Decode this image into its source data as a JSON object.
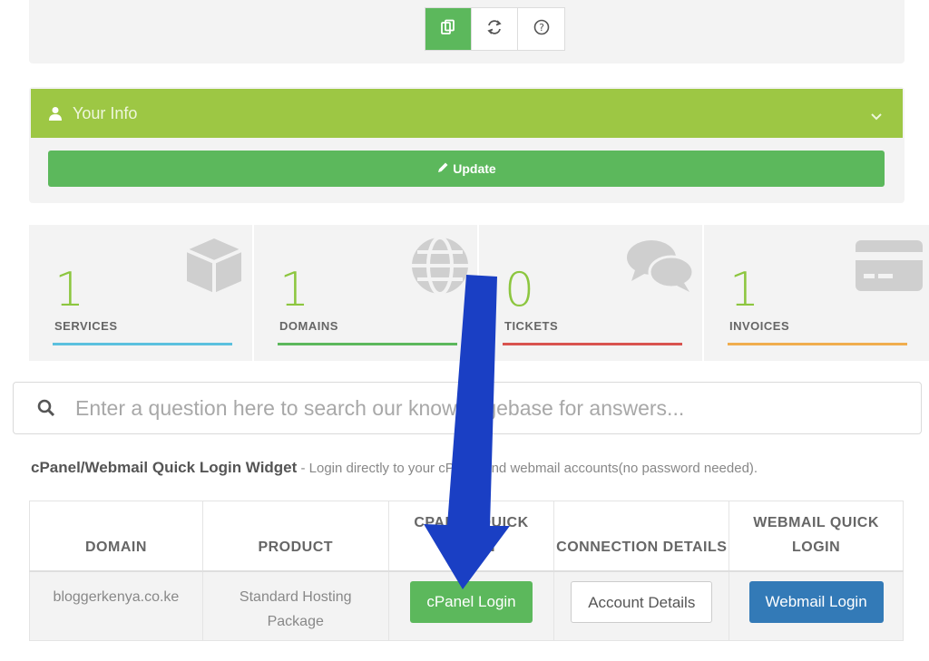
{
  "toolbar": {
    "buttons": [
      {
        "icon": "copy-icon",
        "active": true
      },
      {
        "icon": "refresh-icon",
        "active": false
      },
      {
        "icon": "help-icon",
        "active": false
      }
    ]
  },
  "your_info": {
    "title": "Your Info",
    "update_label": "Update"
  },
  "stats": [
    {
      "value": "1",
      "label": "SERVICES",
      "icon": "box-icon",
      "color": "#5bc0de"
    },
    {
      "value": "1",
      "label": "DOMAINS",
      "icon": "globe-icon",
      "color": "#5cb85c"
    },
    {
      "value": "0",
      "label": "TICKETS",
      "icon": "comments-icon",
      "color": "#d9534f"
    },
    {
      "value": "1",
      "label": "INVOICES",
      "icon": "credit-card-icon",
      "color": "#f0ad4e"
    }
  ],
  "search": {
    "placeholder": "Enter a question here to search our knowledgebase for answers..."
  },
  "widget": {
    "title": "cPanel/Webmail Quick Login Widget",
    "description": " - Login directly to your cPanel and webmail accounts(no password needed)."
  },
  "table": {
    "headers": [
      "DOMAIN",
      "PRODUCT",
      "CPANEL QUICK LOGIN",
      "CONNECTION DETAILS",
      "WEBMAIL QUICK LOGIN"
    ],
    "rows": [
      {
        "domain": "bloggerkenya.co.ke",
        "product": "Standard Hosting Package",
        "cpanel_button": "cPanel Login",
        "details_button": "Account Details",
        "webmail_button": "Webmail Login"
      }
    ]
  },
  "colors": {
    "accent_green": "#9dc744",
    "button_green": "#5cb85c",
    "button_blue": "#337ab7",
    "arrow_blue": "#1a3fc4"
  }
}
